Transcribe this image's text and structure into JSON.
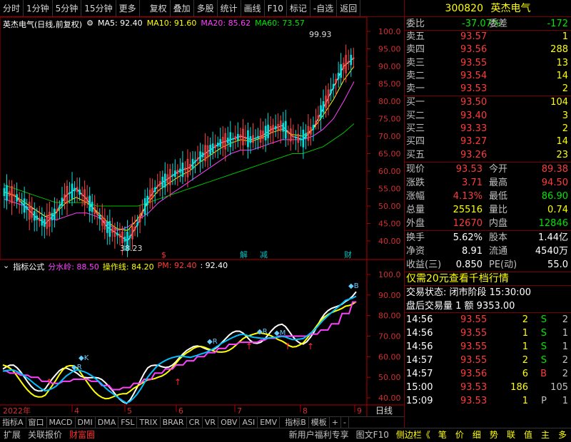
{
  "topbar": {
    "items": [
      "分时",
      "1分钟",
      "5分钟",
      "15分钟",
      "更多",
      "复权",
      "叠加",
      "多股",
      "统计",
      "画线",
      "F10",
      "标记",
      "-自选",
      "返回"
    ]
  },
  "kline": {
    "title": "英杰电气(日线,前复权)",
    "ma5": "MA5: 92.40",
    "ma10": "MA10: 91.60",
    "ma20": "MA20: 85.62",
    "ma60": "MA60: 73.57",
    "high_label": "99.93",
    "low_label": "38.23",
    "y_ticks": [
      "100.0",
      "95.00",
      "90.00",
      "85.00",
      "80.00",
      "75.00",
      "70.00",
      "65.00",
      "60.00",
      "55.00",
      "50.00",
      "45.00",
      "40.00"
    ],
    "markers": [
      "$",
      "解",
      "减",
      "财"
    ]
  },
  "indicator": {
    "title": "指标公式",
    "fsl_label": "分水岭: 88.50",
    "czx_label": "操作线: 84.20",
    "pm_label": "PM: 92.40",
    "last_label": ": 92.40",
    "y_ticks": [
      "100.0",
      "90.00",
      "80.00",
      "70.00",
      "60.00",
      "50.00",
      "40.00"
    ],
    "annotations": [
      "K",
      "R",
      "R",
      "R",
      "M",
      "B"
    ]
  },
  "xaxis": {
    "year": "2022年",
    "months": [
      "4",
      "5",
      "6",
      "7",
      "8",
      "9"
    ],
    "period": "日线"
  },
  "tabs": [
    "指标A",
    "窗口",
    "MACD",
    "DMI",
    "DMA",
    "FSL",
    "TRIX",
    "BRAR",
    "CR",
    "VR",
    "OBV",
    "ASI",
    "EMV",
    "指标B",
    "模板",
    "+",
    "-"
  ],
  "quote": {
    "code": "300820",
    "name": "英杰电气",
    "wb": {
      "label1": "委比",
      "val1": "-37.07%",
      "label2": "委差",
      "val2": "-172"
    },
    "asks": [
      {
        "label": "卖五",
        "price": "93.57",
        "vol": "1"
      },
      {
        "label": "卖四",
        "price": "93.56",
        "vol": "288"
      },
      {
        "label": "卖三",
        "price": "93.55",
        "vol": "13"
      },
      {
        "label": "卖二",
        "price": "93.54",
        "vol": "14"
      },
      {
        "label": "卖一",
        "price": "93.53",
        "vol": "2"
      }
    ],
    "bids": [
      {
        "label": "买一",
        "price": "93.50",
        "vol": "104"
      },
      {
        "label": "买二",
        "price": "93.40",
        "vol": "3"
      },
      {
        "label": "买三",
        "price": "93.33",
        "vol": "2"
      },
      {
        "label": "买四",
        "price": "93.27",
        "vol": "14"
      },
      {
        "label": "买五",
        "price": "93.26",
        "vol": "23"
      }
    ],
    "stats": [
      {
        "l1": "现价",
        "v1": "93.53",
        "l2": "今开",
        "v2": "89.38",
        "c1": "#ff3c3c",
        "c2": "#ff3c3c"
      },
      {
        "l1": "涨跌",
        "v1": "3.71",
        "l2": "最高",
        "v2": "94.50",
        "c1": "#ff3c3c",
        "c2": "#ff3c3c"
      },
      {
        "l1": "涨幅",
        "v1": "4.13%",
        "l2": "最低",
        "v2": "86.90",
        "c1": "#ff3c3c",
        "c2": "#00e600"
      },
      {
        "l1": "总量",
        "v1": "25516",
        "l2": "量比",
        "v2": "0.74",
        "c1": "#ffff00",
        "c2": "#ffff00"
      },
      {
        "l1": "外盘",
        "v1": "12670",
        "l2": "内盘",
        "v2": "12846",
        "c1": "#ff3c3c",
        "c2": "#00e600"
      }
    ],
    "stats2": [
      {
        "l1": "换手",
        "v1": "5.62%",
        "l2": "股本",
        "v2": "1.44亿"
      },
      {
        "l1": "净资",
        "v1": "8.91",
        "l2": "流通",
        "v2": "4540万"
      },
      {
        "l1": "收益(三)",
        "v1": "0.850",
        "l2": "PE(动)",
        "v2": "55.0"
      }
    ],
    "promo": "仅需20元查看千档行情",
    "status1": "交易状态: 闭市阶段 15:30:00",
    "status2": "盘后交易量 1 额 9353.00",
    "ticks": [
      {
        "t": "14:56",
        "p": "93.55",
        "v": "2",
        "s": "S",
        "n": "2"
      },
      {
        "t": "14:56",
        "p": "93.55",
        "v": "1",
        "s": "S",
        "n": "1"
      },
      {
        "t": "14:56",
        "p": "93.55",
        "v": "1",
        "s": "S",
        "n": "1"
      },
      {
        "t": "14:57",
        "p": "93.55",
        "v": "2",
        "s": "S",
        "n": "2"
      },
      {
        "t": "14:57",
        "p": "93.56",
        "v": "6",
        "s": "B",
        "n": "2"
      },
      {
        "t": "15:00",
        "p": "93.53",
        "v": "186",
        "s": "",
        "n": "105"
      },
      {
        "t": "15:09",
        "p": "93.53",
        "v": "1",
        "s": "P",
        "n": "1"
      }
    ]
  },
  "footer": {
    "left": [
      "扩展",
      "关联报价",
      "财富圈"
    ],
    "mid": [
      "新用户福利专享",
      "图文F10",
      "侧边栏《"
    ],
    "right": [
      "笔",
      "价",
      "细",
      "势",
      "联",
      "值",
      "主",
      "多"
    ]
  },
  "chart_data": {
    "type": "line",
    "title": "英杰电气(日线,前复权)",
    "series": [
      {
        "name": "MA5",
        "values": [
          54,
          53,
          50,
          47,
          45,
          48,
          53,
          55,
          52,
          48,
          44,
          42,
          40,
          45,
          52,
          56,
          58,
          60,
          61,
          64,
          66,
          68,
          69,
          70,
          69,
          70,
          72,
          73,
          70,
          69,
          72,
          78,
          84,
          90,
          92.4
        ]
      },
      {
        "name": "MA20",
        "values": [
          52,
          51,
          50,
          49,
          47,
          46,
          47,
          48,
          48,
          47,
          45,
          43,
          44,
          46,
          48,
          51,
          53,
          55,
          57,
          59,
          61,
          63,
          65,
          66,
          66,
          67,
          68,
          69,
          69,
          69,
          70,
          72,
          75,
          80,
          85.62
        ]
      },
      {
        "name": "MA60",
        "values": [
          56,
          55,
          54,
          53,
          52,
          51,
          51,
          51,
          51,
          50,
          50,
          50,
          50,
          50,
          51,
          52,
          53,
          54,
          55,
          56,
          57,
          58,
          59,
          60,
          61,
          62,
          63,
          64,
          65,
          65,
          66,
          67,
          69,
          71,
          73.57
        ]
      }
    ]
  }
}
